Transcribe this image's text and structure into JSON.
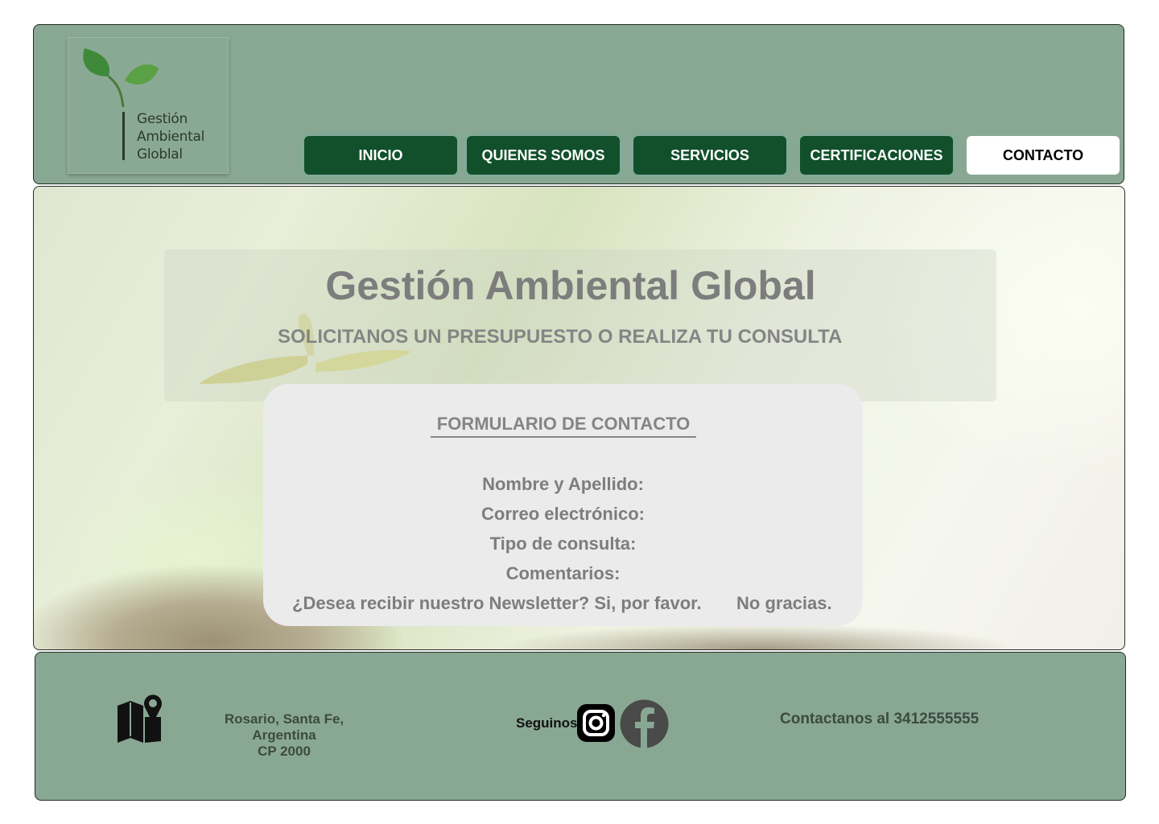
{
  "logo": {
    "lines": [
      "Gestión",
      "Ambiental",
      "Globlal"
    ]
  },
  "nav": {
    "items": [
      {
        "label": "INICIO",
        "active": false
      },
      {
        "label": "QUIENES SOMOS",
        "active": false
      },
      {
        "label": "SERVICIOS",
        "active": false
      },
      {
        "label": "CERTIFICACIONES",
        "active": false
      },
      {
        "label": "CONTACTO",
        "active": true
      }
    ]
  },
  "hero": {
    "title": "Gestión Ambiental Global",
    "subtitle": "SOLICITANOS UN PRESUPUESTO O REALIZA TU CONSULTA"
  },
  "form": {
    "title": "FORMULARIO DE CONTACTO",
    "fields": [
      "Nombre y Apellido:",
      "Correo electrónico:",
      "Tipo de consulta:",
      "Comentarios:"
    ],
    "newsletter_question": "¿Desea recibir nuestro Newsletter?",
    "option_yes": "Si, por favor.",
    "option_no": "No gracias."
  },
  "footer": {
    "address_line1": "Rosario, Santa Fe, Argentina",
    "address_line2": "CP 2000",
    "follow_label": "Seguinos",
    "phone_text": "Contactanos al 3412555555",
    "icons": [
      "map-pin-icon",
      "instagram-icon",
      "facebook-icon"
    ]
  },
  "colors": {
    "header_bg": "#89a894",
    "nav_bg": "#11502b",
    "nav_active_bg": "#ffffff",
    "form_bg": "#ebebeb",
    "text_gray": "#7d7d7d"
  }
}
